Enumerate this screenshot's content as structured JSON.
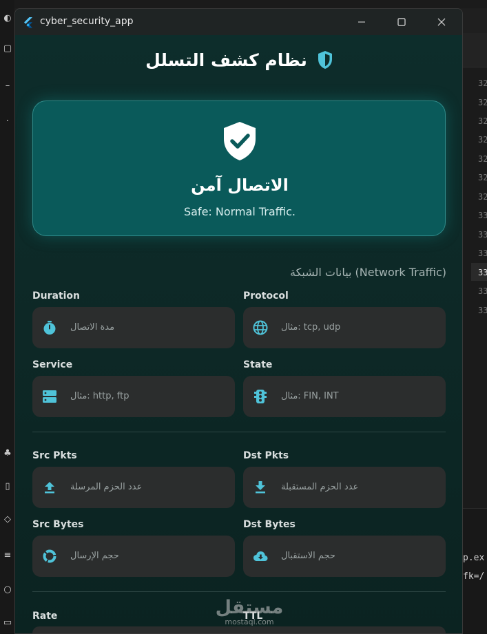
{
  "window": {
    "title": "cyber_security_app"
  },
  "header": {
    "title": "نظام كشف التسلل"
  },
  "status": {
    "title": "الاتصال آمن",
    "subtitle": "Safe: Normal Traffic."
  },
  "section": {
    "title": "بيانات الشبكة (Network Traffic)"
  },
  "fields": {
    "duration": {
      "label": "Duration",
      "placeholder": "مدة الاتصال"
    },
    "protocol": {
      "label": "Protocol",
      "placeholder": "مثال: tcp, udp"
    },
    "service": {
      "label": "Service",
      "placeholder": "مثال: http, ftp"
    },
    "state": {
      "label": "State",
      "placeholder": "مثال: FIN, INT"
    },
    "src_pkts": {
      "label": "Src Pkts",
      "placeholder": "عدد الحزم المرسلة"
    },
    "dst_pkts": {
      "label": "Dst Pkts",
      "placeholder": "عدد الحزم المستقبلة"
    },
    "src_bytes": {
      "label": "Src Bytes",
      "placeholder": "حجم الإرسال"
    },
    "dst_bytes": {
      "label": "Dst Bytes",
      "placeholder": "حجم الاستقبال"
    },
    "rate": {
      "label": "Rate"
    },
    "ttl": {
      "label": "TTL"
    }
  },
  "watermark": {
    "line1": "مستقل",
    "line2": "mostaql.com"
  },
  "background": {
    "line_numbers": [
      "32",
      "32",
      "32",
      "32",
      "32",
      "32",
      "32",
      "33",
      "33",
      "33",
      "33",
      "33",
      "33"
    ],
    "terminal_lines": [
      "p.ex",
      "fk=/"
    ]
  },
  "colors": {
    "accent": "#4fc3d9",
    "status_card": "#0a5a5a",
    "field_bg": "#2b2d2d",
    "window_bg": "#0e2a29"
  },
  "icons": {
    "header": "shield-half-icon",
    "status": "shield-check-icon",
    "duration": "timer-icon",
    "protocol": "globe-icon",
    "service": "server-icon",
    "state": "traffic-light-icon",
    "src_pkts": "upload-icon",
    "dst_pkts": "download-icon",
    "src_bytes": "donut-chart-icon",
    "dst_bytes": "cloud-download-icon"
  }
}
